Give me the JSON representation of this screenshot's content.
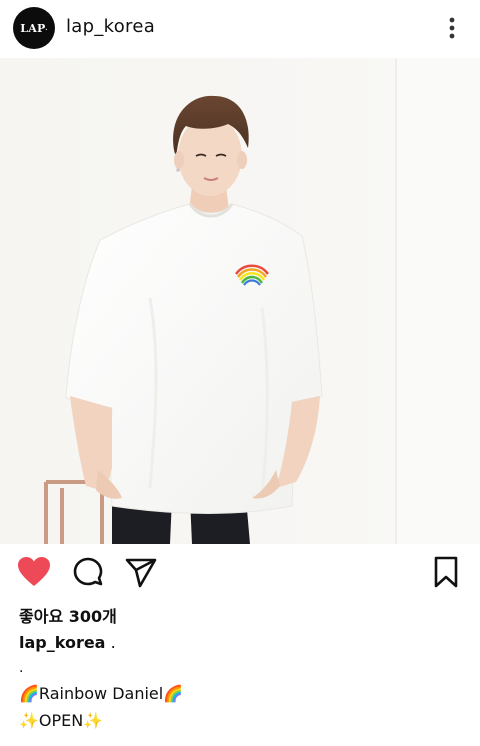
{
  "post": {
    "username": "lap_korea",
    "avatar_text": "LAP",
    "avatar_dot": ".",
    "likes": "좋아요 300개",
    "caption": {
      "user": "lap_korea",
      "first_line_rest": " .",
      "second_line": ".",
      "lines": [
        "🌈Rainbow Daniel🌈",
        "✨OPEN✨"
      ]
    },
    "icons": {
      "more": "more-vertical-icon",
      "like": "heart-icon",
      "comment": "comment-icon",
      "share": "send-icon",
      "save": "bookmark-icon"
    }
  },
  "colors": {
    "like_red": "#ed4956",
    "text": "#111111",
    "avatar_bg": "#0c0c0c"
  }
}
